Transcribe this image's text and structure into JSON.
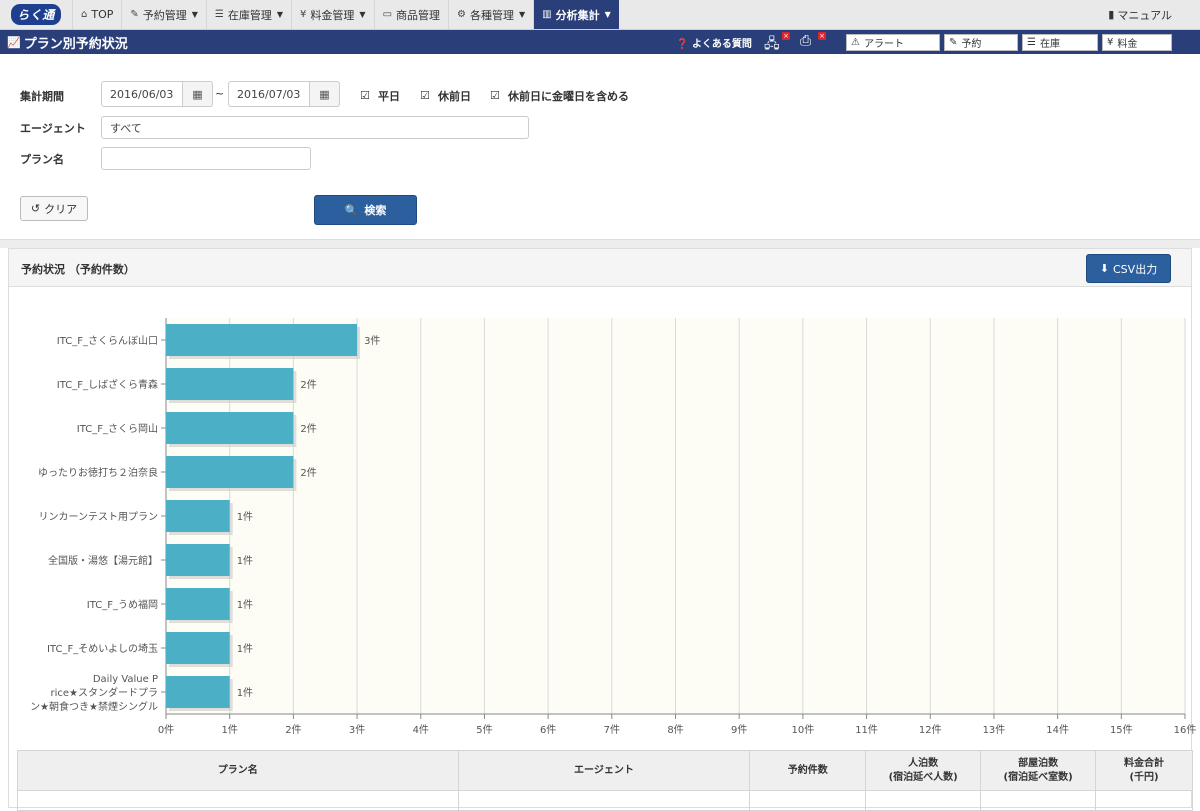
{
  "nav": {
    "logo": "らく通",
    "items": [
      {
        "icon": "home-icon",
        "label": "TOP",
        "has_caret": false
      },
      {
        "icon": "edit-icon",
        "label": "予約管理",
        "has_caret": true
      },
      {
        "icon": "list-icon",
        "label": "在庫管理",
        "has_caret": true
      },
      {
        "icon": "yen-icon",
        "label": "料金管理",
        "has_caret": true
      },
      {
        "icon": "hdd-icon",
        "label": "商品管理",
        "has_caret": false
      },
      {
        "icon": "gear-icon",
        "label": "各種管理",
        "has_caret": true
      },
      {
        "icon": "bar-chart-icon",
        "label": "分析集計",
        "has_caret": true
      }
    ],
    "manual": "マニュアル"
  },
  "titlebar": {
    "title": "プラン別予約状況",
    "faq": "よくある質問",
    "quick_buttons": [
      {
        "icon": "warning-icon",
        "label": "アラート"
      },
      {
        "icon": "edit-icon",
        "label": "予約"
      },
      {
        "icon": "list-icon",
        "label": "在庫"
      },
      {
        "icon": "yen-icon",
        "label": "料金"
      }
    ]
  },
  "form": {
    "period_label": "集計期間",
    "date_from": "2016/06/03",
    "date_sep": "~",
    "date_to": "2016/07/03",
    "checkboxes": [
      "平日",
      "休前日",
      "休前日に金曜日を含める"
    ],
    "agent_label": "エージェント",
    "agent_value": "すべて",
    "plan_label": "プラン名",
    "plan_value": "",
    "clear_label": "クリア",
    "search_label": "検索"
  },
  "panel": {
    "title": "予約状況 （予約件数）",
    "csv_label": "CSV出力"
  },
  "chart_data": {
    "type": "bar",
    "orientation": "horizontal",
    "categories": [
      "ITC_F_さくらんぼ山口",
      "ITC_F_しばざくら青森",
      "ITC_F_さくら岡山",
      "ゆったりお徳打ち２泊奈良",
      "リンカーンテスト用プラン",
      "全国版・湯悠【湯元館】",
      "ITC_F_うめ福岡",
      "ITC_F_そめいよしの埼玉",
      "Daily Value Price★スタンダードプラン★朝食つき★禁煙シングル"
    ],
    "values": [
      3,
      2,
      2,
      2,
      1,
      1,
      1,
      1,
      1
    ],
    "value_suffix": "件",
    "xlim": [
      0,
      16
    ],
    "xticks": [
      "0件",
      "1件",
      "2件",
      "3件",
      "4件",
      "5件",
      "6件",
      "7件",
      "8件",
      "9件",
      "10件",
      "11件",
      "12件",
      "13件",
      "14件",
      "15件",
      "16件"
    ],
    "bar_color": "#4bb0c5",
    "grid": true
  },
  "table": {
    "headers": [
      [
        "プラン名"
      ],
      [
        "エージェント"
      ],
      [
        "予約件数"
      ],
      [
        "人泊数",
        "(宿泊延べ人数)"
      ],
      [
        "部屋泊数",
        "(宿泊延べ室数)"
      ],
      [
        "料金合計",
        "(千円)"
      ]
    ]
  }
}
